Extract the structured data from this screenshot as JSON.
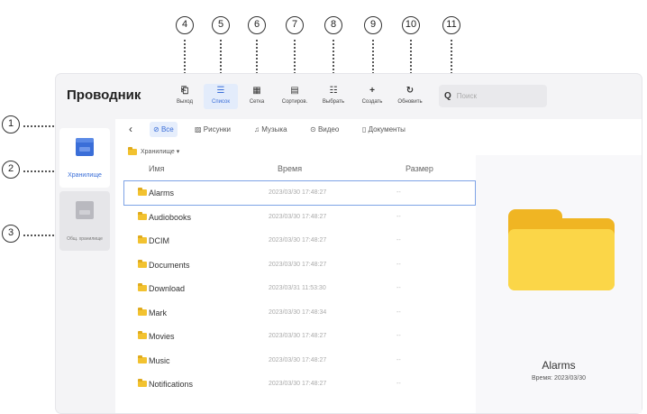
{
  "callouts": [
    "1",
    "2",
    "3",
    "4",
    "5",
    "6",
    "7",
    "8",
    "9",
    "10",
    "11"
  ],
  "window": {
    "title": "Проводник"
  },
  "toolbar": [
    {
      "label": "Выход",
      "icon": "exit-icon",
      "glyph": "⎗"
    },
    {
      "label": "Список",
      "icon": "list-icon",
      "glyph": "☰",
      "active": true
    },
    {
      "label": "Сетка",
      "icon": "grid-icon",
      "glyph": "▦"
    },
    {
      "label": "Сортиров.",
      "icon": "sort-icon",
      "glyph": "▤"
    },
    {
      "label": "Выбрать",
      "icon": "select-icon",
      "glyph": "☷"
    },
    {
      "label": "Создать",
      "icon": "plus-icon",
      "glyph": "+"
    },
    {
      "label": "Обновить",
      "icon": "refresh-icon",
      "glyph": "↻"
    }
  ],
  "search": {
    "placeholder": "Поиск"
  },
  "sidebar": [
    {
      "label": "Хранилище",
      "active": true
    },
    {
      "label": "Общ. хранилище",
      "active": false
    }
  ],
  "categories": [
    {
      "label": "Все",
      "icon": "all-icon",
      "active": true
    },
    {
      "label": "Рисунки",
      "icon": "image-icon"
    },
    {
      "label": "Музыка",
      "icon": "music-icon"
    },
    {
      "label": "Видео",
      "icon": "video-icon"
    },
    {
      "label": "Документы",
      "icon": "document-icon"
    }
  ],
  "breadcrumb": "Хранилище",
  "columns": {
    "name": "Имя",
    "time": "Время",
    "size": "Размер"
  },
  "files": [
    {
      "name": "Alarms",
      "time": "2023/03/30 17:48:27",
      "size": "--",
      "selected": true
    },
    {
      "name": "Audiobooks",
      "time": "2023/03/30 17:48:27",
      "size": "--"
    },
    {
      "name": "DCIM",
      "time": "2023/03/30 17:48:27",
      "size": "--"
    },
    {
      "name": "Documents",
      "time": "2023/03/30 17:48:27",
      "size": "--"
    },
    {
      "name": "Download",
      "time": "2023/03/31 11:53:30",
      "size": "--"
    },
    {
      "name": "Mark",
      "time": "2023/03/30 17:48:34",
      "size": "--"
    },
    {
      "name": "Movies",
      "time": "2023/03/30 17:48:27",
      "size": "--"
    },
    {
      "name": "Music",
      "time": "2023/03/30 17:48:27",
      "size": "--"
    },
    {
      "name": "Notifications",
      "time": "2023/03/30 17:48:27",
      "size": "--"
    }
  ],
  "preview": {
    "name": "Alarms",
    "time": "Время: 2023/03/30"
  },
  "colors": {
    "accent": "#3a6ed8",
    "folder": "#fbd648",
    "folder_dark": "#f0b523"
  }
}
